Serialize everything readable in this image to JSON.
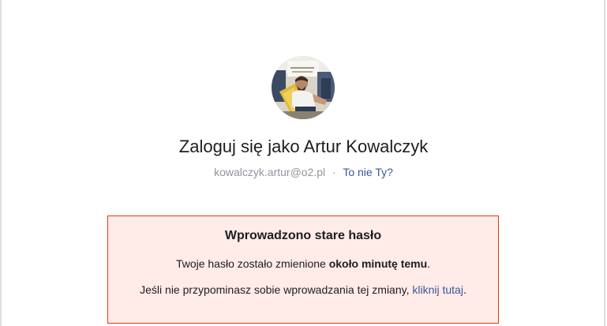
{
  "profile": {
    "avatar_icon": "user-photo-avatar",
    "title": "Zaloguj się jako Artur Kowalczyk",
    "email": "kowalczyk.artur@o2.pl",
    "separator": "·",
    "not_you_link": "To nie Ty?"
  },
  "alert": {
    "title": "Wprowadzono stare hasło",
    "line1_prefix": "Twoje hasło zostało zmienione ",
    "line1_bold": "około minutę temu",
    "line1_suffix": ".",
    "line2_prefix": "Jeśli nie przypominasz sobie wprowadzania tej zmiany, ",
    "line2_link": "kliknij tutaj",
    "line2_suffix": "."
  },
  "colors": {
    "link": "#385898",
    "alert_bg": "#ffebe8",
    "alert_border": "#dd3c10",
    "muted_text": "#90949c"
  }
}
